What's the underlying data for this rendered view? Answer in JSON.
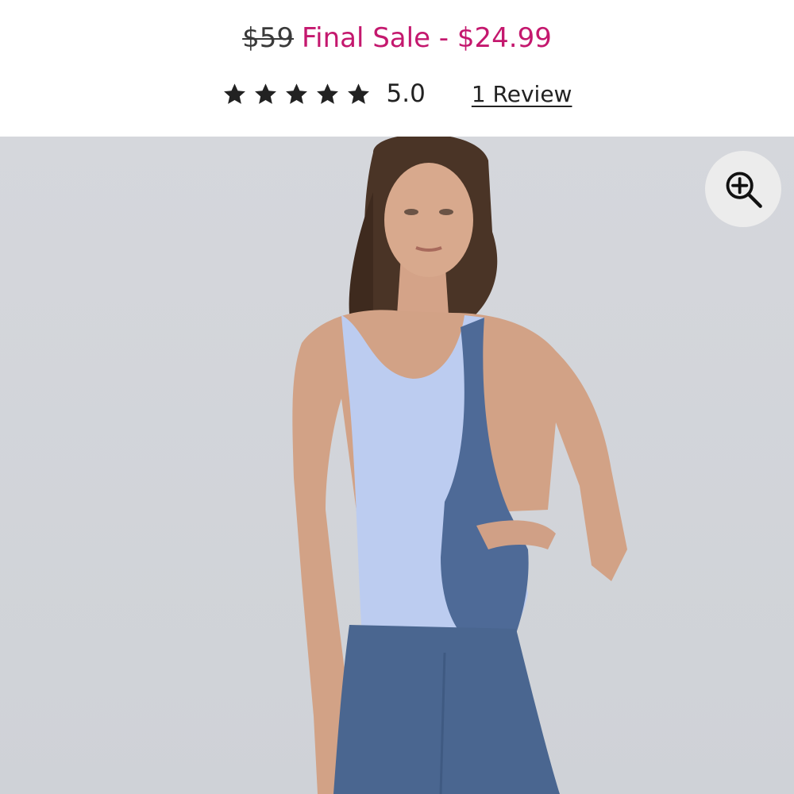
{
  "price": {
    "original": "$59",
    "sale": "Final Sale - $24.99",
    "sale_color": "#c4186e"
  },
  "rating": {
    "stars": 5,
    "score": "5.0",
    "reviews_link": "1 Review"
  },
  "product_image": {
    "description_icon": "product-photo",
    "zoom_icon": "zoom-in-icon"
  }
}
